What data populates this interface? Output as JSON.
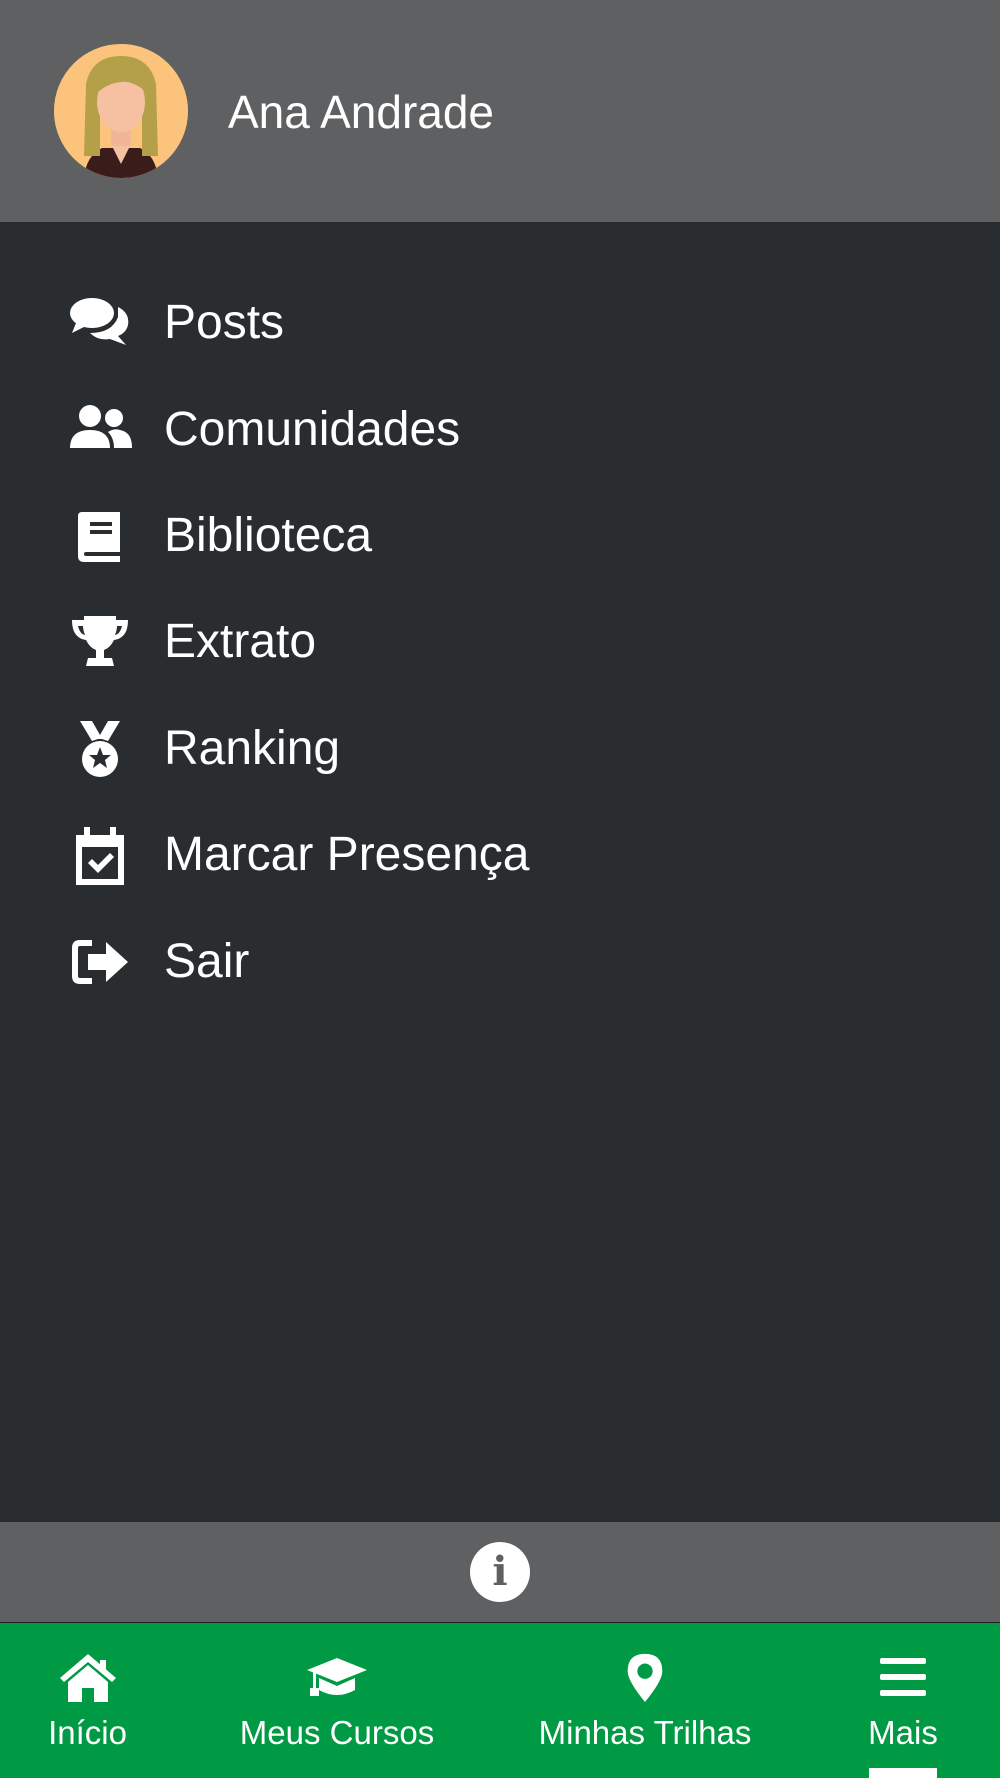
{
  "profile": {
    "name": "Ana Andrade",
    "avatar_icon": "user-avatar-woman"
  },
  "menu": {
    "items": [
      {
        "label": "Posts",
        "icon": "comments-icon"
      },
      {
        "label": "Comunidades",
        "icon": "users-icon"
      },
      {
        "label": "Biblioteca",
        "icon": "book-icon"
      },
      {
        "label": "Extrato",
        "icon": "trophy-icon"
      },
      {
        "label": "Ranking",
        "icon": "medal-icon"
      },
      {
        "label": "Marcar Presença",
        "icon": "calendar-check-icon"
      },
      {
        "label": "Sair",
        "icon": "sign-out-icon"
      }
    ]
  },
  "info": {
    "icon": "info-icon"
  },
  "bottom_nav": {
    "items": [
      {
        "label": "Início",
        "icon": "home-icon"
      },
      {
        "label": "Meus Cursos",
        "icon": "graduation-cap-icon"
      },
      {
        "label": "Minhas Trilhas",
        "icon": "map-marker-icon"
      },
      {
        "label": "Mais",
        "icon": "menu-bars-icon",
        "active": true
      }
    ]
  },
  "colors": {
    "drawer_bg": "#2a2d30",
    "header_bg": "#5f6062",
    "nav_bg": "#009a44",
    "text": "#ffffff",
    "avatar_bg": "#fbc37c"
  }
}
